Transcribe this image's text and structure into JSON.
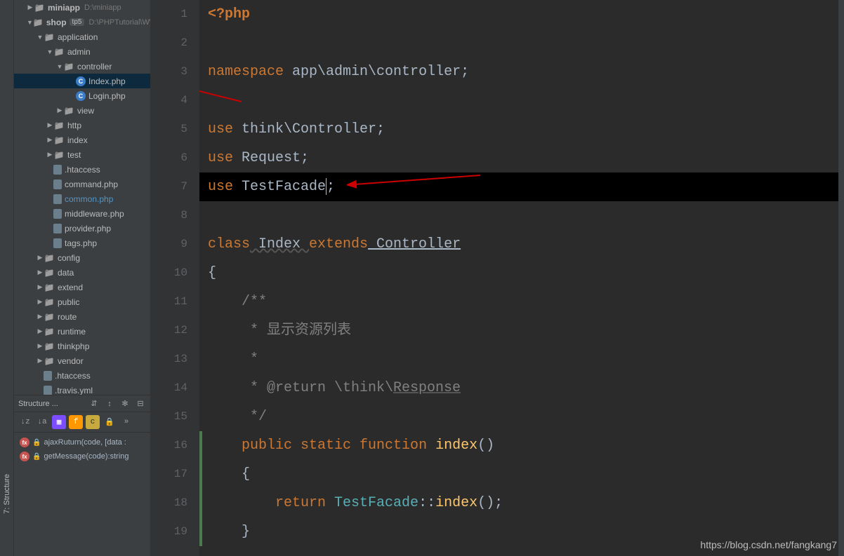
{
  "vertical_tab": "7: Structure",
  "tree": {
    "miniapp": {
      "name": "miniapp",
      "path": "D:\\miniapp"
    },
    "shop": {
      "name": "shop",
      "tag": "tp5",
      "path": "D:\\PHPTutorial\\WW"
    },
    "application": "application",
    "admin": "admin",
    "controller": "controller",
    "index_php": "Index.php",
    "login_php": "Login.php",
    "view": "view",
    "http": "http",
    "index": "index",
    "test": "test",
    "htaccess": ".htaccess",
    "command_php": "command.php",
    "common_php": "common.php",
    "middleware_php": "middleware.php",
    "provider_php": "provider.php",
    "tags_php": "tags.php",
    "config": "config",
    "data": "data",
    "extend": "extend",
    "public": "public",
    "route": "route",
    "runtime": "runtime",
    "thinkphp": "thinkphp",
    "vendor": "vendor",
    "htaccess2": ".htaccess",
    "travis": ".travis.yml"
  },
  "structure": {
    "title": "Structure ...",
    "items": [
      {
        "label": "ajaxRuturn(code, [data :"
      },
      {
        "label": "getMessage(code):string"
      }
    ]
  },
  "code": {
    "l1_open": "<?php",
    "l3_ns_kw": "namespace",
    "l3_ns_val": " app\\admin\\controller;",
    "l5_use": "use",
    "l5_val": " think\\Controller;",
    "l6_use": "use",
    "l6_val": " Request;",
    "l7_use": "use",
    "l7_val": " TestFacade",
    "l7_semi": ";",
    "l9_class": "class",
    "l9_name": " Index ",
    "l9_extends": "extends",
    "l9_ctrl": " Controller",
    "l10": "{",
    "l11": "    /**",
    "l12": "     * 显示资源列表",
    "l13": "     *",
    "l14_a": "     * @return \\think\\",
    "l14_b": "Response",
    "l15": "     */",
    "l16_public": "    public",
    "l16_static": " static",
    "l16_function": " function",
    "l16_name": " index",
    "l16_paren": "()",
    "l17": "    {",
    "l18_return": "        return",
    "l18_cls": " TestFacade",
    "l18_dcolon": "::",
    "l18_method": "index",
    "l18_end": "();",
    "l19": "    }"
  },
  "line_numbers": [
    "1",
    "2",
    "3",
    "4",
    "5",
    "6",
    "7",
    "8",
    "9",
    "10",
    "11",
    "12",
    "13",
    "14",
    "15",
    "16",
    "17",
    "18",
    "19"
  ],
  "watermark": "https://blog.csdn.net/fangkang7"
}
